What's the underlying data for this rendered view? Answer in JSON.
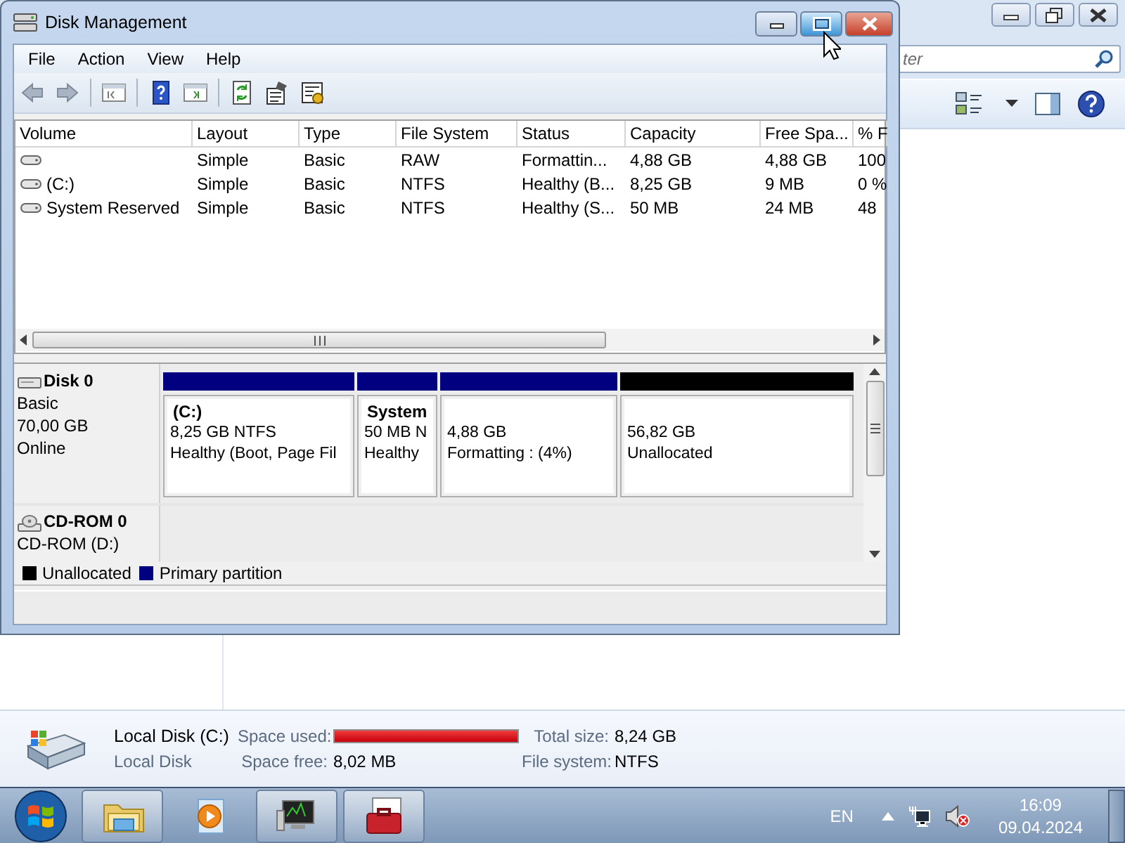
{
  "background_window": {
    "search": {
      "placeholder": "ter"
    },
    "details_pane": {
      "name": "Local Disk (C:)",
      "type": "Local Disk",
      "space_used": {
        "label": "Space used:",
        "level": 0.999
      },
      "space_free": {
        "label": "Space free:",
        "value": "8,02 MB"
      },
      "total_size": {
        "label": "Total size:",
        "value": "8,24 GB"
      },
      "file_system": {
        "label": "File system:",
        "value": "NTFS"
      }
    }
  },
  "window": {
    "title": "Disk Management",
    "caption_buttons": [
      {
        "kind": "minimize",
        "hovered": false
      },
      {
        "kind": "maximize",
        "hovered": true
      },
      {
        "kind": "close",
        "hovered": false
      }
    ],
    "menu": [
      "File",
      "Action",
      "View",
      "Help"
    ],
    "volume_table": {
      "columns": [
        "Volume",
        "Layout",
        "Type",
        "File System",
        "Status",
        "Capacity",
        "Free Spa...",
        "% F"
      ],
      "rows": [
        {
          "cells": [
            "",
            "Simple",
            "Basic",
            "RAW",
            "Formattin...",
            "4,88 GB",
            "4,88 GB",
            "100"
          ]
        },
        {
          "cells": [
            "(C:)",
            "Simple",
            "Basic",
            "NTFS",
            "Healthy (B...",
            "8,25 GB",
            "9 MB",
            "0 %"
          ]
        },
        {
          "cells": [
            "System Reserved",
            "Simple",
            "Basic",
            "NTFS",
            "Healthy (S...",
            "50 MB",
            "24 MB",
            "48"
          ]
        }
      ]
    },
    "disks": [
      {
        "kind": "disk",
        "name": "Disk 0",
        "lines": [
          "Basic",
          "70,00 GB",
          "Online"
        ],
        "partitions": [
          {
            "color": "#000080",
            "name": "(C:)",
            "lines": [
              "8,25 GB NTFS",
              "Healthy (Boot, Page Fil"
            ]
          },
          {
            "color": "#000080",
            "name": "System",
            "lines": [
              "50 MB N",
              "Healthy"
            ]
          },
          {
            "color": "#000080",
            "lines": [
              "4,88 GB",
              "Formatting : (4%)"
            ]
          },
          {
            "color": "#000000",
            "lines": [
              "56,82 GB",
              "Unallocated"
            ]
          }
        ]
      },
      {
        "kind": "cdrom",
        "name": "CD-ROM 0",
        "lines": [
          "CD-ROM (D:)"
        ]
      }
    ],
    "legend": [
      {
        "label": "Unallocated",
        "color": "#000000"
      },
      {
        "label": "Primary partition",
        "color": "#000080"
      }
    ]
  },
  "taskbar": {
    "items": [
      {
        "kind": "explorer",
        "running": true
      },
      {
        "kind": "media",
        "running": false
      },
      {
        "kind": "monitor",
        "running": true
      },
      {
        "kind": "toolbox",
        "running": true
      }
    ],
    "tray": {
      "language": "EN",
      "time": "16:09",
      "date": "09.04.2024"
    }
  }
}
